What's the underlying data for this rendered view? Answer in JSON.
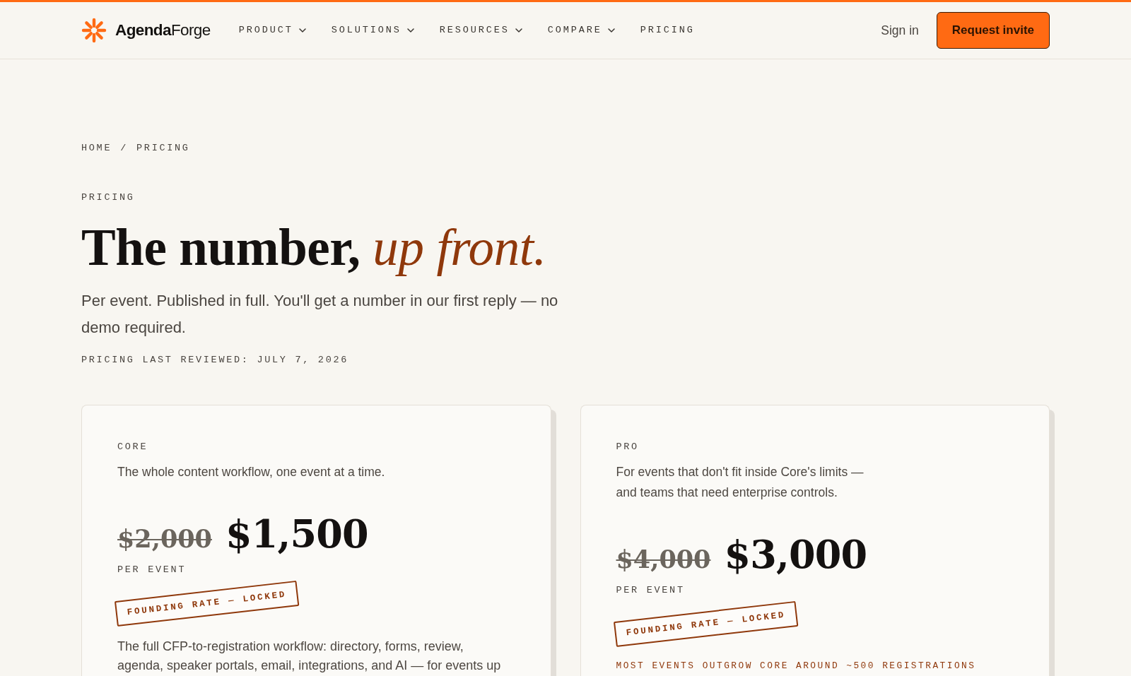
{
  "navbar": {
    "brand": "**Agenda**Forge",
    "links": [
      {
        "label": "PRODUCT",
        "kind": "dropdown"
      },
      {
        "label": "SOLUTIONS",
        "kind": "dropdown"
      },
      {
        "label": "RESOURCES",
        "kind": "dropdown"
      },
      {
        "label": "COMPARE",
        "kind": "dropdown"
      },
      {
        "label": "PRICING",
        "kind": "link"
      }
    ],
    "sign_in": "Sign in",
    "cta": "Request invite"
  },
  "breadcrumb": {
    "items": [
      "HOME",
      "PRICING"
    ],
    "separator": "/"
  },
  "hero": {
    "eyebrow": "PRICING",
    "title": "The number, *up front.*",
    "subtitle": "Per event. Published in full. You'll get a number in our first reply — no demo required.",
    "reviewed": "PRICING LAST REVIEWED: JULY 7, 2026"
  },
  "plans": [
    {
      "name": "CORE",
      "description": "The whole content workflow, one event at a time.",
      "old_price": "$2,000",
      "price": "$1,500",
      "unit": "PER EVENT",
      "stamp": "FOUNDING RATE — LOCKED",
      "details": "The full CFP-to-registration workflow: directory, forms, review, agenda, speaker portals, email, integrations, and AI — for events up"
    },
    {
      "name": "PRO",
      "description": "For events that don't fit inside Core's limits —\nand teams that need enterprise controls.",
      "old_price": "$4,000",
      "price": "$3,000",
      "unit": "PER EVENT",
      "stamp": "FOUNDING RATE — LOCKED",
      "note": "MOST EVENTS OUTGROW CORE AROUND ~500 REGISTRATIONS"
    }
  ]
}
